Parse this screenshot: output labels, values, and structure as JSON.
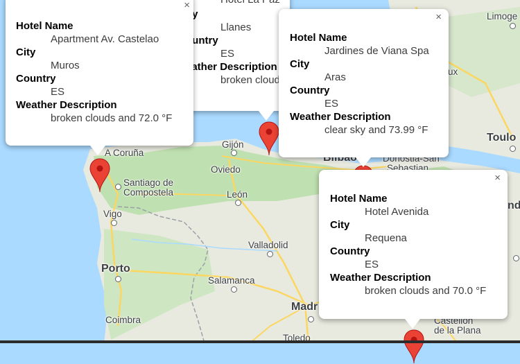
{
  "map": {
    "cities": [
      {
        "name": "Limoge",
        "big": false
      },
      {
        "name": "Toulo",
        "big": false
      },
      {
        "name": "A Coruña",
        "big": false
      },
      {
        "name": "Gijón",
        "big": false
      },
      {
        "name": "Oviedo",
        "big": false
      },
      {
        "name": "Santiago de",
        "big": false
      },
      {
        "name": "Compostela",
        "big": false
      },
      {
        "name": "León",
        "big": false
      },
      {
        "name": "Vigo",
        "big": false
      },
      {
        "name": "Valladolid",
        "big": false
      },
      {
        "name": "Porto",
        "big": true
      },
      {
        "name": "Salamanca",
        "big": false
      },
      {
        "name": "Madr",
        "big": true
      },
      {
        "name": "Coimbra",
        "big": false
      },
      {
        "name": "Toledo",
        "big": false
      },
      {
        "name": "Bilbao",
        "big": false
      },
      {
        "name": "Donostia-San",
        "big": false
      },
      {
        "name": "Sebastian",
        "big": false
      },
      {
        "name": "ux",
        "big": false
      },
      {
        "name": "nd",
        "big": false
      },
      {
        "name": "Castellón",
        "big": false
      },
      {
        "name": "de la Plana",
        "big": false
      }
    ]
  },
  "info_windows": [
    {
      "id": "apartment-castelao",
      "close": "×",
      "fields": [
        {
          "label": "Hotel Name",
          "value": "Apartment Av. Castelao"
        },
        {
          "label": "City",
          "value": "Muros"
        },
        {
          "label": "Country",
          "value": "ES"
        },
        {
          "label": "Weather Description",
          "value": "broken clouds and 72.0 °F"
        }
      ]
    },
    {
      "id": "llanes-partial",
      "close": "",
      "fields": [
        {
          "label": "ity",
          "value": ""
        },
        {
          "label": "",
          "value": "Llanes"
        },
        {
          "label": "ountry",
          "value": "ES"
        },
        {
          "label": "eather Description",
          "value": "broken cloud"
        }
      ]
    },
    {
      "id": "jardines-viana",
      "close": "×",
      "fields": [
        {
          "label": "Hotel Name",
          "value": "Jardines de Viana Spa"
        },
        {
          "label": "City",
          "value": "Aras"
        },
        {
          "label": "Country",
          "value": "ES"
        },
        {
          "label": "Weather Description",
          "value": "clear sky and 73.99 °F"
        }
      ]
    },
    {
      "id": "hotel-avenida",
      "close": "×",
      "fields": [
        {
          "label": "Hotel Name",
          "value": "Hotel Avenida"
        },
        {
          "label": "City",
          "value": "Requena"
        },
        {
          "label": "Country",
          "value": "ES"
        },
        {
          "label": "Weather Description",
          "value": "broken clouds and 70.0 °F"
        }
      ]
    }
  ],
  "colors": {
    "water": "#aadaff",
    "land": "#e8eadf",
    "green": "#bfe0b0",
    "highway": "#fbd761",
    "marker": "#ea4335"
  }
}
